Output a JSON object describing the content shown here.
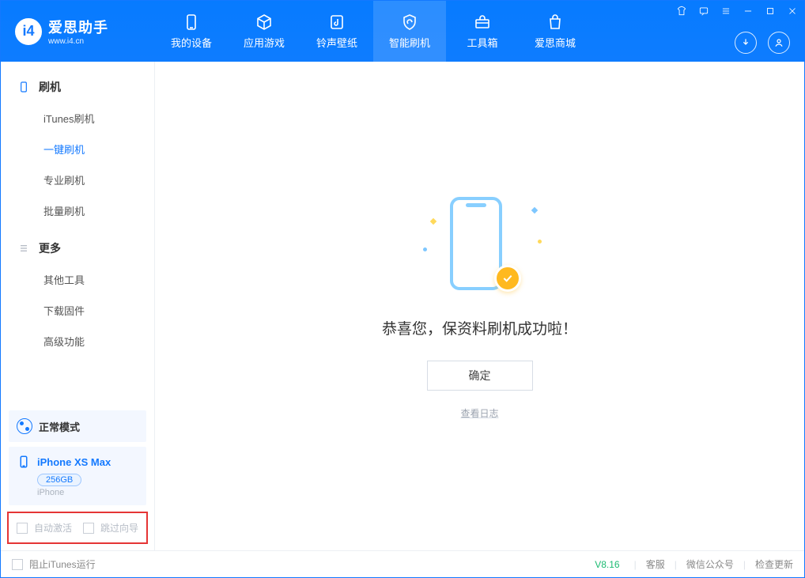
{
  "app": {
    "title": "爱思助手",
    "subtitle": "www.i4.cn"
  },
  "nav": {
    "items": [
      {
        "label": "我的设备"
      },
      {
        "label": "应用游戏"
      },
      {
        "label": "铃声壁纸"
      },
      {
        "label": "智能刷机"
      },
      {
        "label": "工具箱"
      },
      {
        "label": "爱思商城"
      }
    ]
  },
  "sidebar": {
    "section1": {
      "title": "刷机",
      "items": [
        "iTunes刷机",
        "一键刷机",
        "专业刷机",
        "批量刷机"
      ]
    },
    "section2": {
      "title": "更多",
      "items": [
        "其他工具",
        "下载固件",
        "高级功能"
      ]
    },
    "mode": "正常模式",
    "device": {
      "name": "iPhone XS Max",
      "capacity": "256GB",
      "type": "iPhone"
    },
    "checkboxes": {
      "auto_activate": "自动激活",
      "skip_guide": "跳过向导"
    }
  },
  "main": {
    "success_text": "恭喜您，保资料刷机成功啦！",
    "ok_button": "确定",
    "log_link": "查看日志"
  },
  "status": {
    "block_itunes": "阻止iTunes运行",
    "version": "V8.16",
    "links": [
      "客服",
      "微信公众号",
      "检查更新"
    ]
  }
}
